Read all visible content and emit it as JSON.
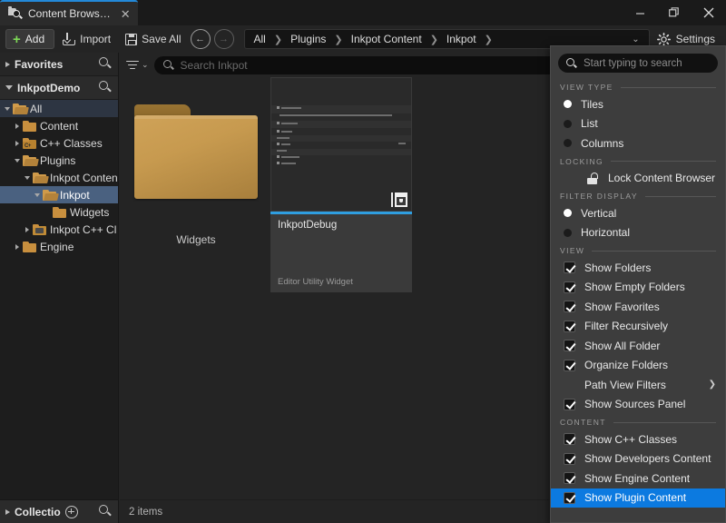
{
  "window": {
    "tab_title": "Content Brows…",
    "tab_close": "✕",
    "minimize": "minimize-icon",
    "maximize": "restore-icon",
    "close": "close-icon"
  },
  "toolbar": {
    "add_label": "Add",
    "add_plus": "+",
    "import_label": "Import",
    "save_all_label": "Save All",
    "back_arrow": "←",
    "forward_arrow": "→",
    "settings_label": "Settings",
    "breadcrumb": [
      "All",
      "Plugins",
      "Inkpot Content",
      "Inkpot"
    ],
    "breadcrumb_sep": "❯",
    "breadcrumb_caret": "⌄"
  },
  "sources": {
    "favorites_label": "Favorites",
    "project_label": "InkpotDemo",
    "collections_label": "Collectio",
    "tree": [
      {
        "label": "All",
        "depth": 0,
        "arrow": "open",
        "icon": "folder-open",
        "state": "root"
      },
      {
        "label": "Content",
        "depth": 1,
        "arrow": "closed",
        "icon": "folder",
        "state": ""
      },
      {
        "label": "C++ Classes",
        "depth": 1,
        "arrow": "closed",
        "icon": "folder-cpp",
        "state": ""
      },
      {
        "label": "Plugins",
        "depth": 1,
        "arrow": "open",
        "icon": "folder-open",
        "state": ""
      },
      {
        "label": "Inkpot Conten",
        "depth": 2,
        "arrow": "open",
        "icon": "folder-open",
        "state": ""
      },
      {
        "label": "Inkpot",
        "depth": 3,
        "arrow": "open",
        "icon": "folder-open",
        "state": "selected"
      },
      {
        "label": "Widgets",
        "depth": 4,
        "arrow": "none",
        "icon": "folder",
        "state": ""
      },
      {
        "label": "Inkpot C++ Cl",
        "depth": 2,
        "arrow": "closed",
        "icon": "folder-cppp",
        "state": ""
      },
      {
        "label": "Engine",
        "depth": 1,
        "arrow": "closed",
        "icon": "folder",
        "state": ""
      }
    ]
  },
  "content": {
    "filter_icon": "filter-funnel-icon",
    "filter_caret": "⌄",
    "search_placeholder": "Search Inkpot",
    "status": "2 items",
    "items": [
      {
        "kind": "folder",
        "name": "Widgets"
      },
      {
        "kind": "asset",
        "name": "InkpotDebug",
        "type": "Editor Utility Widget",
        "accent": "#2f9ee0"
      }
    ]
  },
  "view_menu": {
    "search_placeholder": "Start typing to search",
    "sections": [
      {
        "title": "VIEW TYPE",
        "items": [
          {
            "label": "Tiles",
            "control": "radio",
            "checked": true
          },
          {
            "label": "List",
            "control": "radio",
            "checked": false
          },
          {
            "label": "Columns",
            "control": "radio",
            "checked": false
          }
        ]
      },
      {
        "title": "LOCKING",
        "items": [
          {
            "label": "Lock Content Browser",
            "control": "lock",
            "checked": false
          }
        ]
      },
      {
        "title": "FILTER DISPLAY",
        "items": [
          {
            "label": "Vertical",
            "control": "radio",
            "checked": true
          },
          {
            "label": "Horizontal",
            "control": "radio",
            "checked": false
          }
        ]
      },
      {
        "title": "VIEW",
        "items": [
          {
            "label": "Show Folders",
            "control": "check",
            "checked": true
          },
          {
            "label": "Show Empty Folders",
            "control": "check",
            "checked": true
          },
          {
            "label": "Show Favorites",
            "control": "check",
            "checked": true
          },
          {
            "label": "Filter Recursively",
            "control": "check",
            "checked": true
          },
          {
            "label": "Show All Folder",
            "control": "check",
            "checked": true
          },
          {
            "label": "Organize Folders",
            "control": "check",
            "checked": true
          },
          {
            "label": "Path View Filters",
            "control": "submenu",
            "checked": false,
            "arrow": "❯"
          },
          {
            "label": "Show Sources Panel",
            "control": "check",
            "checked": true
          }
        ]
      },
      {
        "title": "CONTENT",
        "items": [
          {
            "label": "Show C++ Classes",
            "control": "check",
            "checked": true
          },
          {
            "label": "Show Developers Content",
            "control": "check",
            "checked": true
          },
          {
            "label": "Show Engine Content",
            "control": "check",
            "checked": true
          },
          {
            "label": "Show Plugin Content",
            "control": "check",
            "checked": true,
            "highlight": true
          }
        ]
      }
    ]
  },
  "colors": {
    "accent_blue": "#0c7ae0",
    "tab_accent": "#2389d8",
    "asset_accent": "#2f9ee0",
    "folder_gold": "#c79a4f",
    "add_green": "#7ed957",
    "tree_selected": "#4a6180"
  }
}
